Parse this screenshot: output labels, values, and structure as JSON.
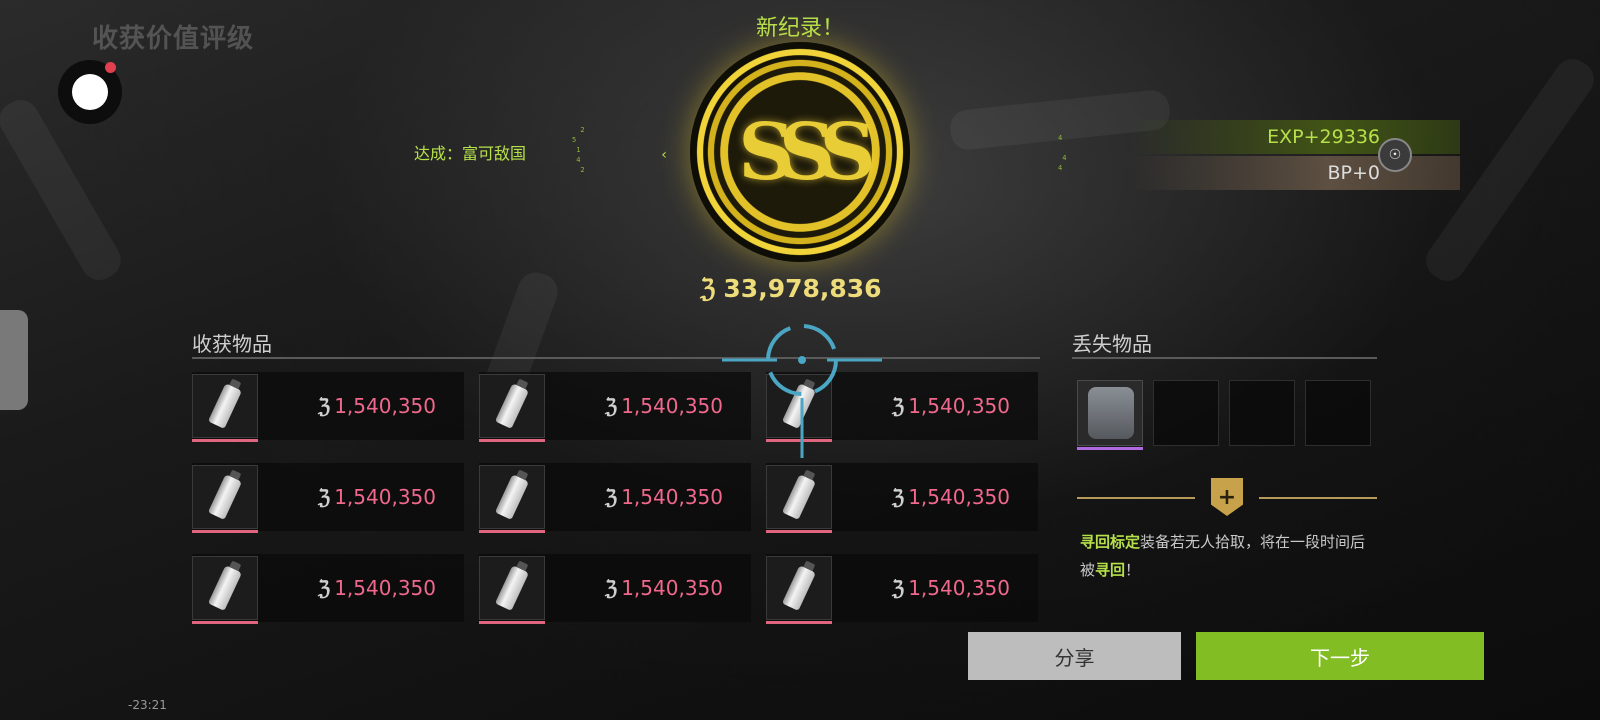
{
  "header": {
    "title": "收获价值评级"
  },
  "record_badge": {
    "text": "新纪录！"
  },
  "achievement": {
    "label": "达成：富可敌国"
  },
  "rating": {
    "grade": "SSS",
    "total_value": "33,978,836",
    "currency_icon": "coin-icon"
  },
  "rewards": {
    "exp": "EXP+29336",
    "bp": "BP+0"
  },
  "collected": {
    "title": "收获物品",
    "items": [
      {
        "price": "1,540,350"
      },
      {
        "price": "1,540,350"
      },
      {
        "price": "1,540,350"
      },
      {
        "price": "1,540,350"
      },
      {
        "price": "1,540,350"
      },
      {
        "price": "1,540,350"
      },
      {
        "price": "1,540,350"
      },
      {
        "price": "1,540,350"
      },
      {
        "price": "1,540,350"
      }
    ]
  },
  "lost": {
    "title": "丢失物品"
  },
  "retrieve": {
    "keyword": "寻回标定",
    "text1": "装备若无人拾取，将在一段时间后被",
    "keyword2": "寻回",
    "text2": "！"
  },
  "buttons": {
    "share": "分享",
    "next": "下一步"
  },
  "timer": "-23:21",
  "colors": {
    "accent_green": "#82bd23",
    "price_pink": "#f0688c",
    "gold": "#e3c229"
  }
}
